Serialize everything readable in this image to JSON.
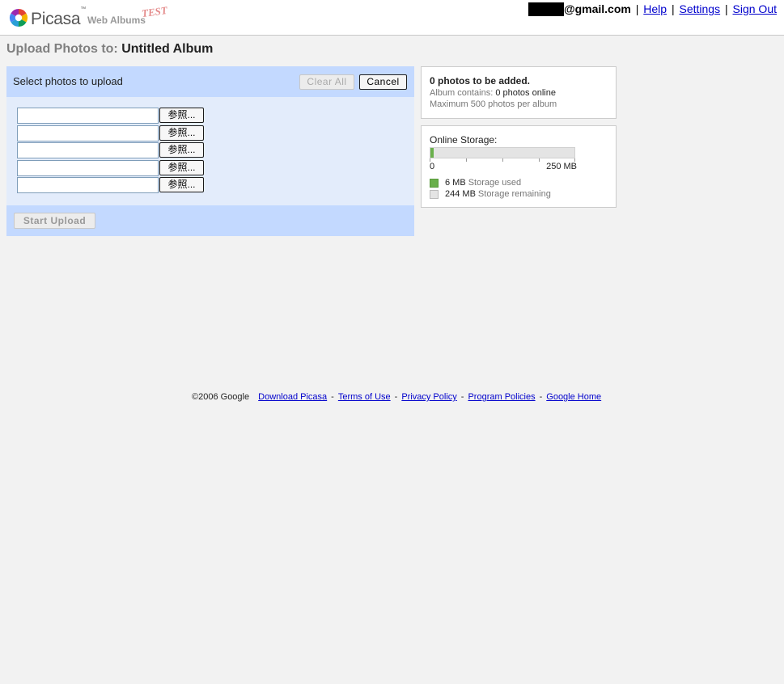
{
  "logo": {
    "brand": "Picasa",
    "tm": "™",
    "product": "Web Albums",
    "tag": "TEST"
  },
  "account": {
    "email_suffix": "@gmail.com",
    "links": [
      "Help",
      "Settings",
      "Sign Out"
    ]
  },
  "page": {
    "title_label": "Upload Photos to:",
    "album_name": "Untitled Album"
  },
  "upload": {
    "caption": "Select photos to upload",
    "clear_label": "Clear All",
    "cancel_label": "Cancel",
    "browse_label": "参照...",
    "start_label": "Start Upload"
  },
  "summary": {
    "headline": "0 photos to be added.",
    "contains_label": "Album contains:",
    "contains_value": "0 photos online",
    "max_note": "Maximum 500 photos per album"
  },
  "storage": {
    "title": "Online Storage:",
    "min_label": "0",
    "max_label": "250 MB",
    "used_fraction": 0.024,
    "used_value": "6 MB",
    "used_desc": "Storage used",
    "free_value": "244 MB",
    "free_desc": "Storage remaining",
    "used_color": "#6ab04c",
    "free_color": "#e4e4e4"
  },
  "footer": {
    "copyright": "©2006 Google",
    "links": [
      "Download Picasa",
      "Terms of Use",
      "Privacy Policy",
      "Program Policies",
      "Google Home"
    ]
  }
}
